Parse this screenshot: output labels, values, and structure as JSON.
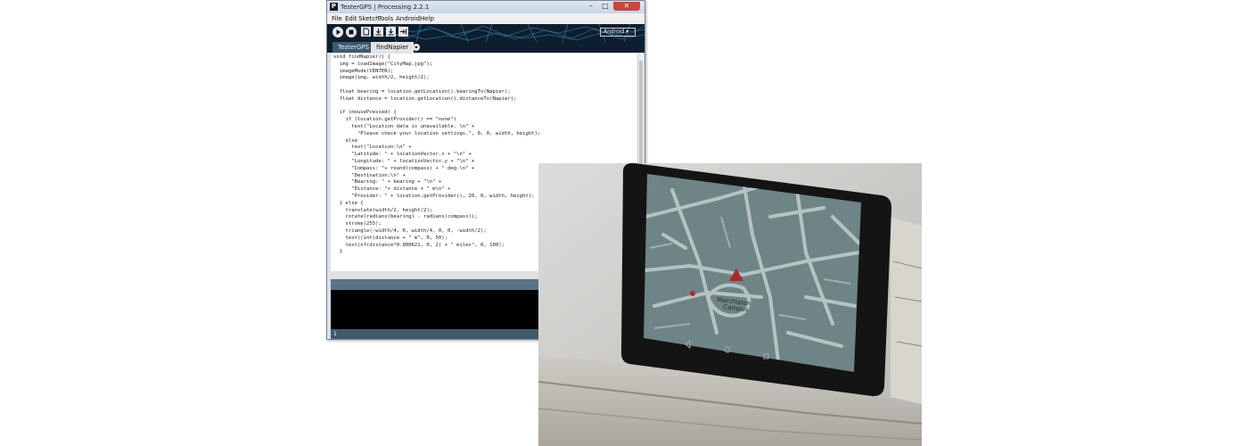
{
  "window": {
    "title": "TesterGPS | Processing 2.2.1",
    "app_icon_letter": "P",
    "controls": {
      "minimize": "–",
      "maximize": "□",
      "close": "✕"
    }
  },
  "menu": [
    "File",
    "Edit",
    "Sketch",
    "Tools",
    "Android",
    "Help"
  ],
  "toolbar": {
    "buttons": [
      "run-icon",
      "stop-icon",
      "new-icon",
      "open-icon",
      "save-icon",
      "export-icon"
    ],
    "mode": "Android ▾"
  },
  "tabs": [
    {
      "label": "TesterGPS",
      "active": false
    },
    {
      "label": "findNapier",
      "active": true
    }
  ],
  "editor": {
    "lines": [
      "void findNapier() {",
      "  img = loadImage(\"CityMap.jpg\");",
      "  imageMode(CENTER);",
      "  image(img, width/2, height/2);",
      "",
      "  float bearing = location.getLocation().bearingTo(Napier);",
      "  float distance = location.getLocation().distanceTo(Napier);",
      "",
      "  if (mousePressed) {",
      "    if (location.getProvider() == \"none\")",
      "      text(\"Location data is unavailable. \\n\" +",
      "        \"Please check your location settings.\", 0, 0, width, height);",
      "    else",
      "      text(\"Location:\\n\" +",
      "      \"Latitude: \" + locationVector.x + \"\\n\" +",
      "      \"Longitude: \" + locationVector.y + \"\\n\" +",
      "      \"Compass: \"+ round(compass) + \" deg.\\n\" +",
      "      \"Destination:\\n\" +",
      "      \"Bearing: \" + bearing + \"\\n\" +",
      "      \"Distance: \"+ distance + \" m\\n\" +",
      "      \"Provider: \" + location.getProvider(), 20, 0, width, height);",
      "  } else {",
      "    translate(width/2, height/2);",
      "    rotate(radians(bearing) - radians(compass));",
      "    stroke(255);",
      "    triangle(-width/4, 0, width/4, 0, 0, -width/2);",
      "    text((int)distance + \" m\", 0, 50);",
      "    text(nf(distance*0.000621, 0, 2) + \" miles\", 0, 100);",
      "  }"
    ]
  },
  "status": {
    "line_number": "1"
  },
  "photo": {
    "map_labels": [
      "Merchiston",
      "Campus"
    ],
    "nav_buttons": [
      "back-icon",
      "home-icon",
      "recents-icon"
    ],
    "colors": {
      "map_bg": "#6f8485",
      "roads": "#b6c3c4",
      "marker": "#b1262a"
    }
  }
}
